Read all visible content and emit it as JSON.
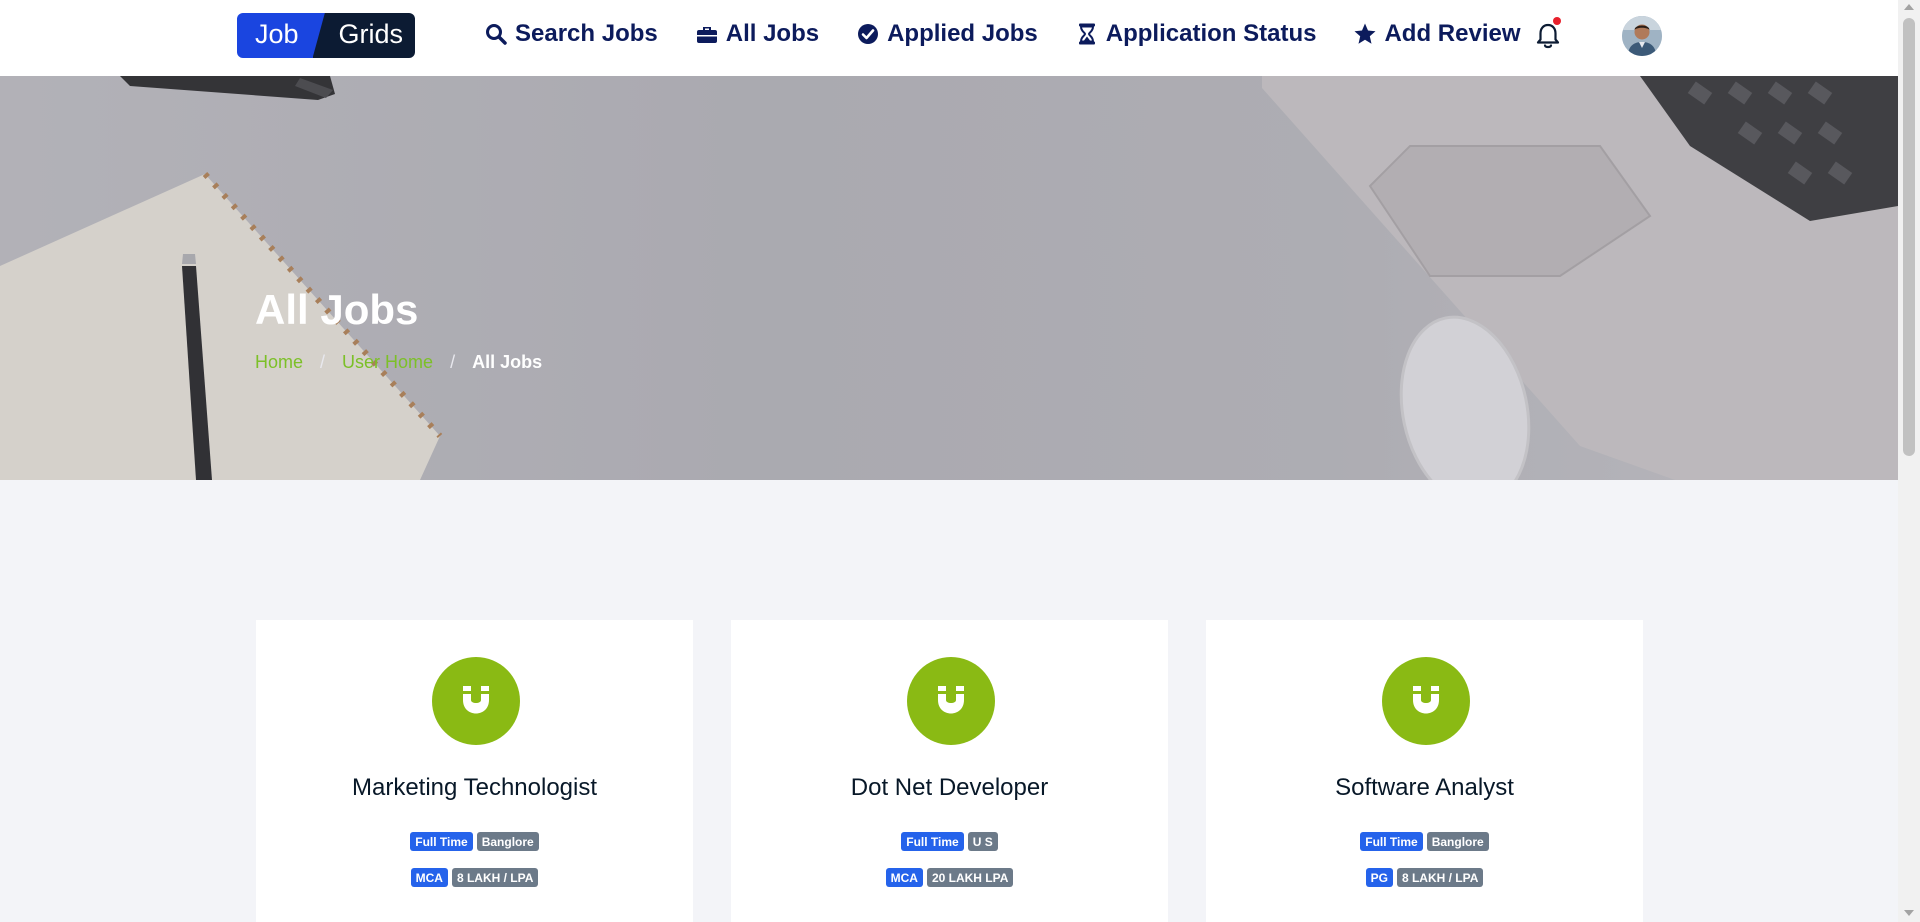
{
  "brand": {
    "part1": "Job",
    "part2": "Grids"
  },
  "nav": [
    {
      "label": "Search Jobs",
      "icon": "search-icon"
    },
    {
      "label": "All Jobs",
      "icon": "briefcase-icon"
    },
    {
      "label": "Applied Jobs",
      "icon": "check-circle-icon"
    },
    {
      "label": "Application Status",
      "icon": "hourglass-icon"
    },
    {
      "label": "Add Review",
      "icon": "star-icon"
    }
  ],
  "header": {
    "notification_icon": "bell-icon",
    "avatar": "user-avatar"
  },
  "hero": {
    "title": "All Jobs",
    "breadcrumb": [
      "Home",
      "User Home",
      "All Jobs"
    ]
  },
  "jobs": [
    {
      "title": "Marketing Technologist",
      "type": "Full Time",
      "location": "Banglore",
      "qualification": "MCA",
      "salary": "8 LAKH / LPA"
    },
    {
      "title": "Dot Net Developer",
      "type": "Full Time",
      "location": "U S",
      "qualification": "MCA",
      "salary": "20 LAKH LPA"
    },
    {
      "title": "Software Analyst",
      "type": "Full Time",
      "location": "Banglore",
      "qualification": "PG",
      "salary": "8 LAKH / LPA"
    }
  ],
  "colors": {
    "brand_blue": "#1a45e0",
    "nav_text": "#0c1b5c",
    "company_logo": "#8aba14",
    "breadcrumb_link": "#7cc028",
    "tag_blue": "#2563eb",
    "tag_grey": "#6c7a89"
  }
}
